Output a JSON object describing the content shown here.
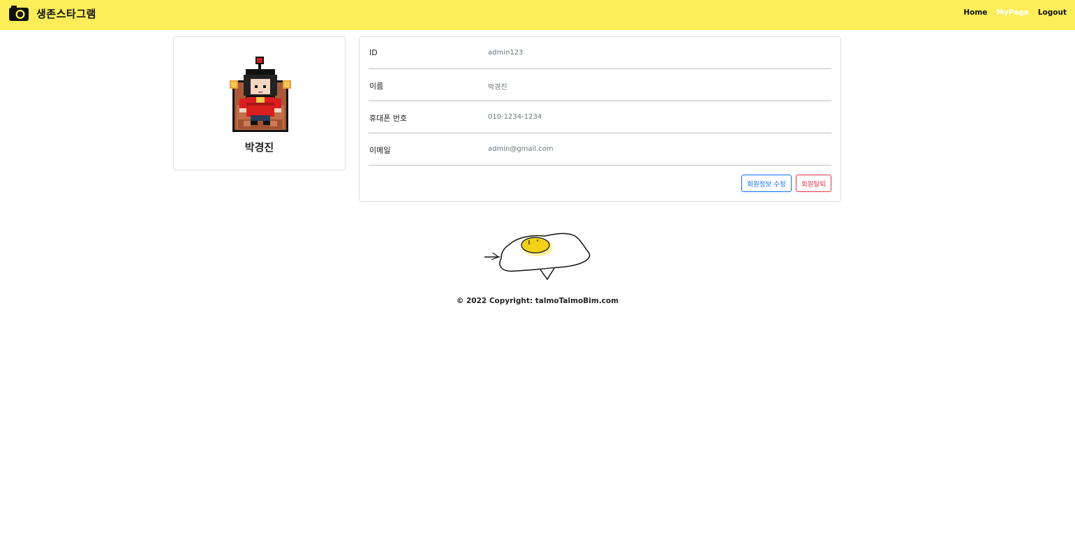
{
  "navbar": {
    "brand_icon": "camera-icon",
    "brand": "생존스타그램",
    "links": [
      {
        "label": "Home",
        "active": false
      },
      {
        "label": "MyPage",
        "active": true
      },
      {
        "label": "Logout",
        "active": false
      }
    ]
  },
  "profile": {
    "avatar": "pixel-king-on-throne-avatar",
    "name": "박경진"
  },
  "info": {
    "rows": [
      {
        "label": "ID",
        "value": "admin123"
      },
      {
        "label": "이름",
        "value": "박경진"
      },
      {
        "label": "휴대폰 번호",
        "value": "010-1234-1234"
      },
      {
        "label": "이메일",
        "value": "admin@gmail.com"
      }
    ],
    "edit_button": "회원정보 수정",
    "withdraw_button": "회원탈퇴"
  },
  "footer": {
    "illustration": "fried-egg-drawing",
    "copyright": "© 2022 Copyright: talmoTalmoBim.com"
  },
  "colors": {
    "navbar_bg": "#fced59",
    "primary": "#0d6efd",
    "danger": "#dc3545"
  }
}
